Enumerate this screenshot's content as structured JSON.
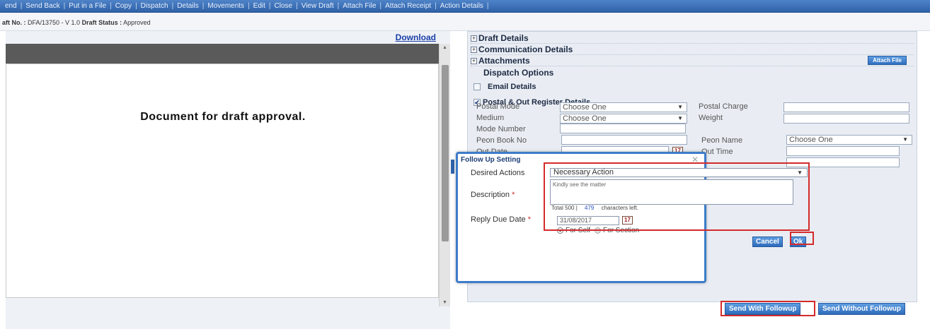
{
  "toolbar": {
    "items": [
      "end",
      "Send Back",
      "Put in a File",
      "Copy",
      "Dispatch",
      "Details",
      "Movements",
      "Edit",
      "Close",
      "View Draft",
      "Attach File",
      "Attach Receipt",
      "Action Details"
    ]
  },
  "info": {
    "draft_no_label": "aft No. :",
    "draft_no": "DFA/13750 - V 1.0",
    "status_label": "Draft Status :",
    "status": "Approved"
  },
  "viewer": {
    "download_label": "Download",
    "document_text": "Document for draft approval."
  },
  "right": {
    "sections": [
      "Draft Details",
      "Communication Details",
      "Attachments"
    ],
    "attach_file_label": "Attach File",
    "dispatch_options": "Dispatch Options",
    "email_details": "Email Details",
    "postal_details": "Postal & Out Register Details",
    "fields": {
      "postal_mode": "Postal Mode",
      "postal_mode_value": "Choose One",
      "postal_charge": "Postal Charge",
      "medium": "Medium",
      "medium_value": "Choose One",
      "weight": "Weight",
      "mode_number": "Mode Number",
      "peon_book_no": "Peon Book No",
      "peon_name": "Peon Name",
      "peon_name_value": "Choose One",
      "out_date": "Out Date",
      "out_time": "Out Time"
    },
    "calendar_glyph": "17"
  },
  "modal": {
    "title": "Follow Up Setting",
    "close_glyph": "✕",
    "desired_actions_label": "Desired Actions",
    "desired_actions_value": "Necessary Action",
    "description_label": "Description",
    "description_value": "Kindly see the matter",
    "required_mark": "*",
    "total_label": "Total 500 |",
    "chars_left_value": "479",
    "chars_left_label": "characters left.",
    "reply_due_label": "Reply Due Date",
    "reply_due_value": "31/08/2017",
    "for_self": "For Self",
    "for_section": "For Section",
    "cancel_label": "Cancel",
    "ok_label": "Ok"
  },
  "actions": {
    "send_with_followup": "Send With Followup",
    "send_without_followup": "Send Without Followup"
  },
  "colors": {
    "accent": "#2f62a8",
    "highlight_outline": "#d42a2a"
  }
}
